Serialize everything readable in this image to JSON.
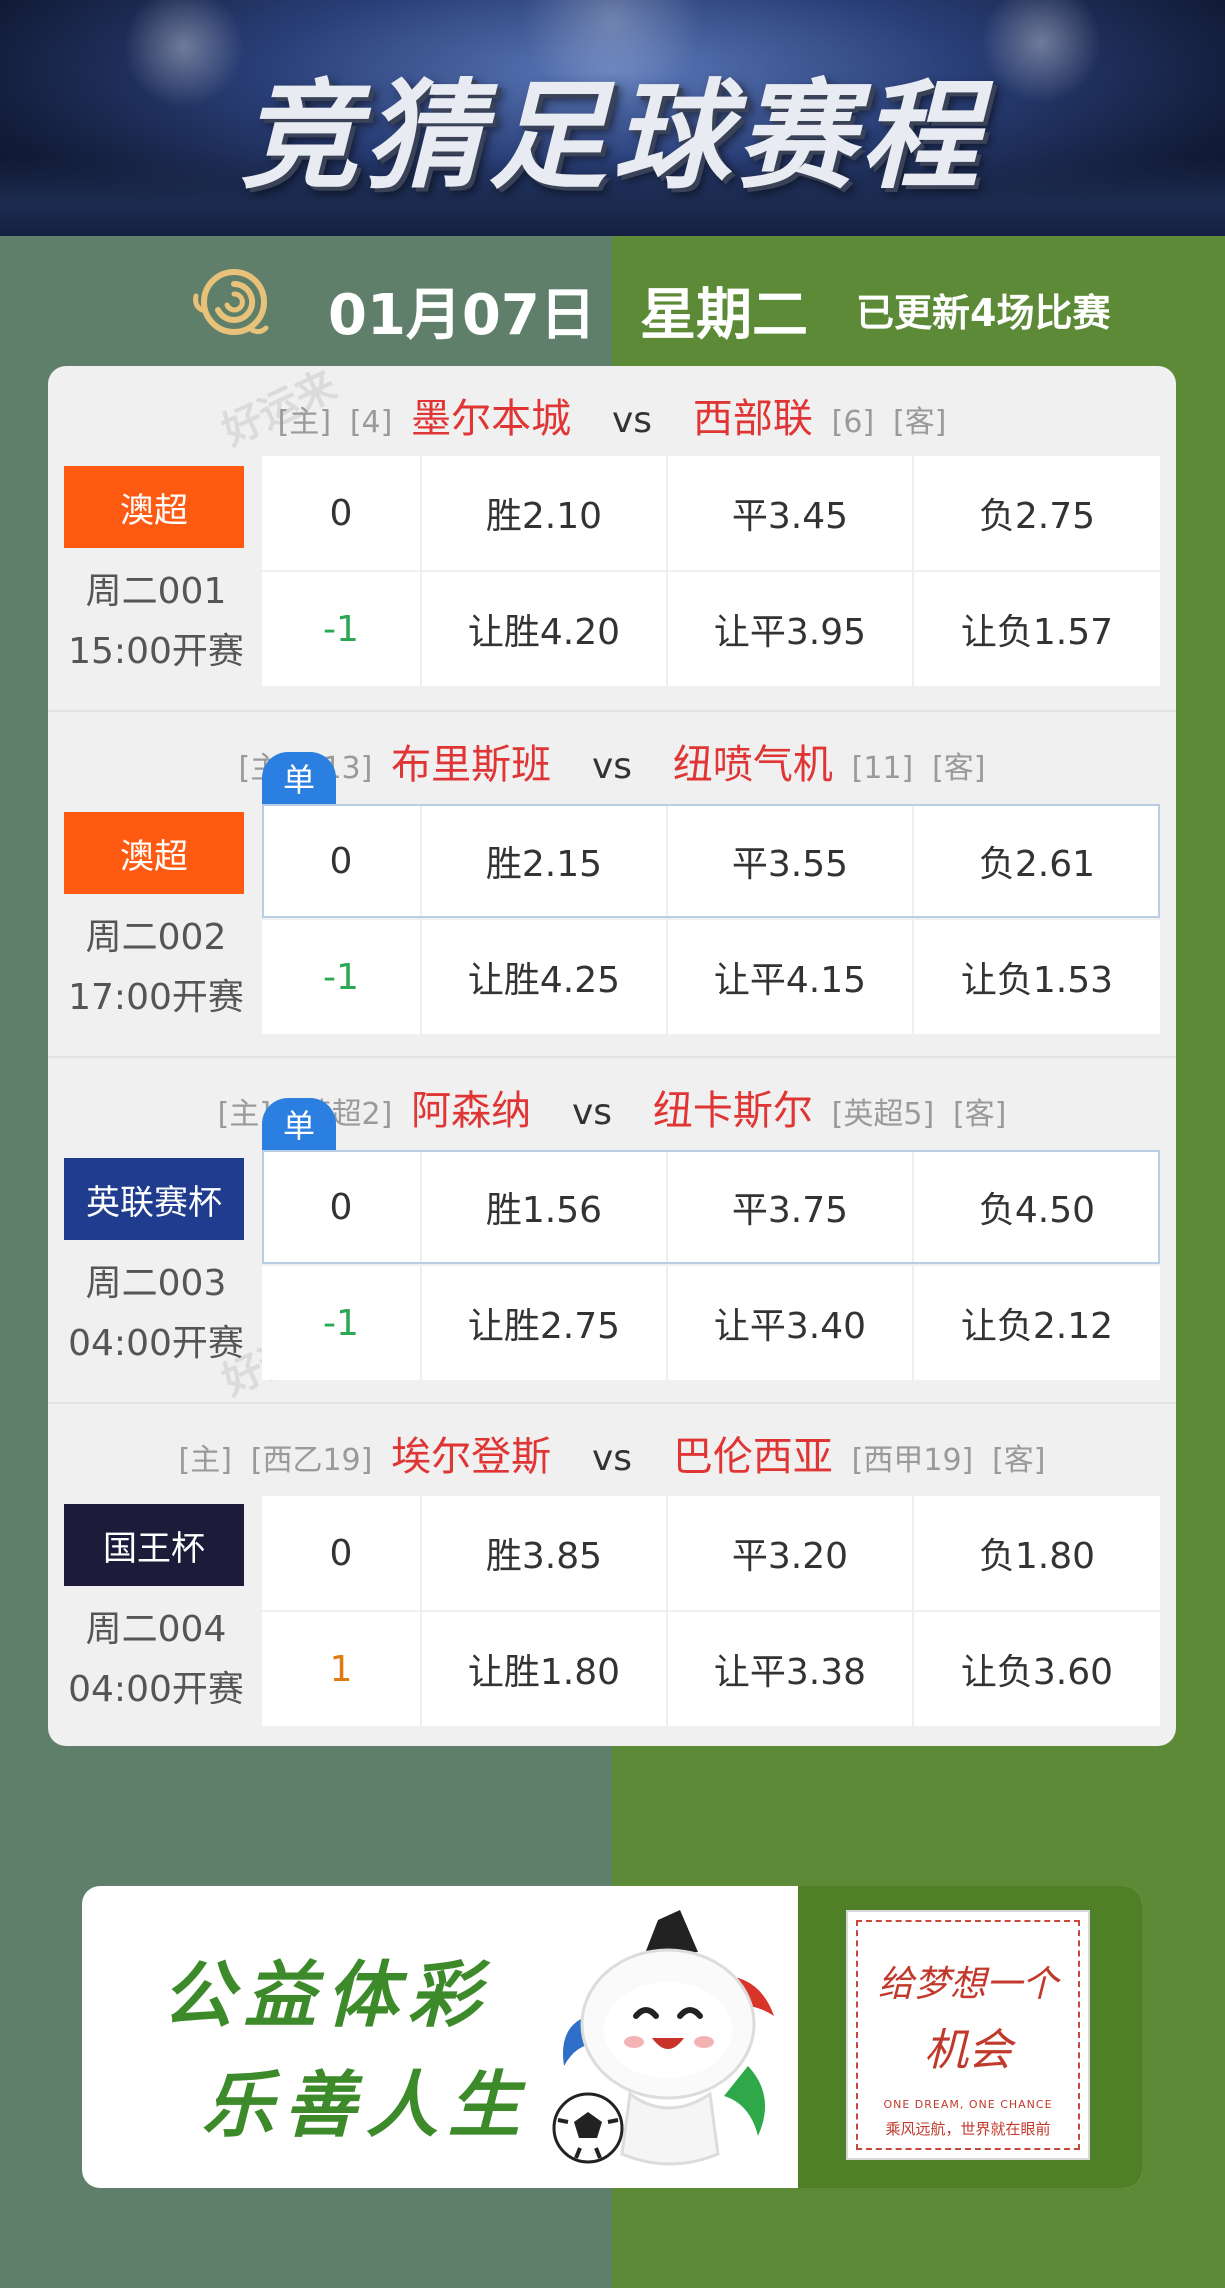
{
  "banner": {
    "title": "竞猜足球赛程"
  },
  "header": {
    "date": "01月07日",
    "weekday": "星期二",
    "update": "已更新4场比赛"
  },
  "watermark": "好运来",
  "matches": [
    {
      "home_tag": "[主]",
      "home_rank": "[4]",
      "home": "墨尔本城",
      "vs": "vs",
      "away": "西部联",
      "away_rank": "[6]",
      "away_tag": "[客]",
      "league": "澳超",
      "league_color": "#ff5a12",
      "match_no": "周二001",
      "kickoff": "15:00开赛",
      "single": false,
      "row1": {
        "handicap": "0",
        "win": "胜2.10",
        "draw": "平3.45",
        "lose": "负2.75"
      },
      "row2": {
        "handicap": "-1",
        "win": "让胜4.20",
        "draw": "让平3.95",
        "lose": "让负1.57"
      }
    },
    {
      "home_tag": "[主]",
      "home_rank": "[13]",
      "home": "布里斯班",
      "vs": "vs",
      "away": "纽喷气机",
      "away_rank": "[11]",
      "away_tag": "[客]",
      "league": "澳超",
      "league_color": "#ff5a12",
      "match_no": "周二002",
      "kickoff": "17:00开赛",
      "single": true,
      "single_label": "单",
      "row1": {
        "handicap": "0",
        "win": "胜2.15",
        "draw": "平3.55",
        "lose": "负2.61"
      },
      "row2": {
        "handicap": "-1",
        "win": "让胜4.25",
        "draw": "让平4.15",
        "lose": "让负1.53"
      }
    },
    {
      "home_tag": "[主]",
      "home_rank": "[英超2]",
      "home": "阿森纳",
      "vs": "vs",
      "away": "纽卡斯尔",
      "away_rank": "[英超5]",
      "away_tag": "[客]",
      "league": "英联赛杯",
      "league_color": "#1f3c8f",
      "match_no": "周二003",
      "kickoff": "04:00开赛",
      "single": true,
      "single_label": "单",
      "row1": {
        "handicap": "0",
        "win": "胜1.56",
        "draw": "平3.75",
        "lose": "负4.50"
      },
      "row2": {
        "handicap": "-1",
        "win": "让胜2.75",
        "draw": "让平3.40",
        "lose": "让负2.12"
      }
    },
    {
      "home_tag": "[主]",
      "home_rank": "[西乙19]",
      "home": "埃尔登斯",
      "vs": "vs",
      "away": "巴伦西亚",
      "away_rank": "[西甲19]",
      "away_tag": "[客]",
      "league": "国王杯",
      "league_color": "#1d1b3a",
      "match_no": "周二004",
      "kickoff": "04:00开赛",
      "single": false,
      "row1": {
        "handicap": "0",
        "win": "胜3.85",
        "draw": "平3.20",
        "lose": "负1.80"
      },
      "row2": {
        "handicap": "1",
        "win": "让胜1.80",
        "draw": "让平3.38",
        "lose": "让负3.60"
      }
    }
  ],
  "ad": {
    "line1": "公益体彩",
    "line2": "乐善人生",
    "poster_main_1": "给梦想一个",
    "poster_main_2": "机会",
    "poster_en": "ONE DREAM, ONE CHANCE",
    "poster_cn": "乘风远航，世界就在眼前"
  }
}
